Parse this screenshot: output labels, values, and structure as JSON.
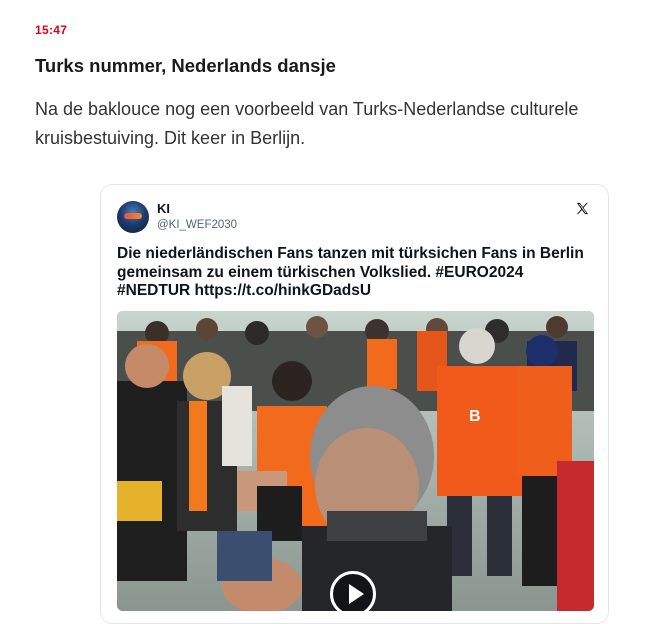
{
  "article": {
    "time": "15:47",
    "headline": "Turks nummer, Nederlands dansje",
    "body": "Na de baklouce nog een voorbeeld van Turks-Nederlandse culturele kruisbestuiving. Dit keer in Berlijn."
  },
  "tweet": {
    "author_name": "KI",
    "author_handle": "@KI_WEF2030",
    "text": "Die niederländischen Fans tanzen mit türksichen Fans in Berlin gemeinsam zu einem türkischen Volkslied. #EURO2024 #NEDTUR https://t.co/hinkGDadsU",
    "platform_icon": "x-logo-icon",
    "media": {
      "type": "video",
      "shirt_text": "B",
      "play_icon": "play-icon"
    }
  },
  "colors": {
    "time_red": "#e1001a",
    "headline": "#1a1a1a",
    "orange": "#f26a1b",
    "card_border": "#e3e6e8"
  }
}
